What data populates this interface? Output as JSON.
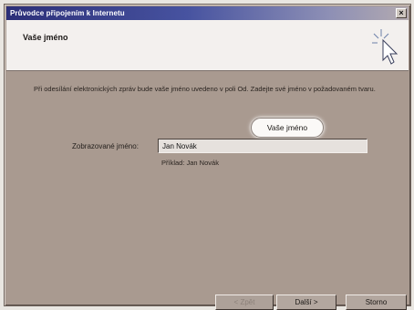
{
  "window": {
    "title": "Průvodce připojením k Internetu",
    "close_label": "×"
  },
  "header": {
    "heading": "Vaše jméno",
    "icon": "wizard-hand-icon"
  },
  "body": {
    "instructions": "Při odesílání elektronických zpráv bude vaše jméno uvedeno v poli Od. Zadejte své jméno v požadovaném tvaru.",
    "field_label": "Zobrazované jméno:",
    "field_value": "Jan Novák",
    "example": "Příklad: Jan Novák",
    "callout": "Vaše jméno"
  },
  "buttons": {
    "back": "< Zpět",
    "next": "Další >",
    "cancel": "Storno"
  }
}
